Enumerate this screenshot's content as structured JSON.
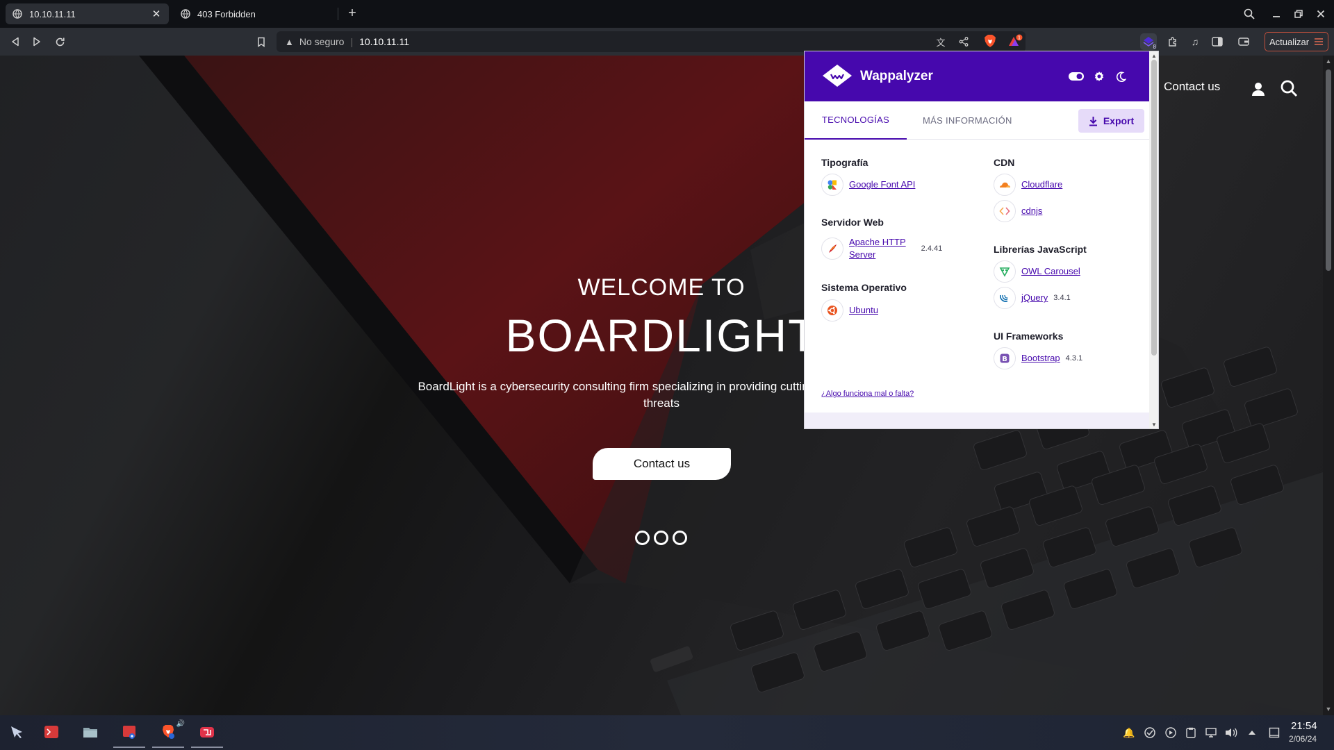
{
  "browser": {
    "tabs": [
      {
        "title": "10.10.11.11",
        "active": true
      },
      {
        "title": "403 Forbidden",
        "active": false
      }
    ],
    "address": {
      "security_label": "No seguro",
      "host": "10.10.11.11"
    },
    "update_label": "Actualizar",
    "extension_badge": "8",
    "rewards_badge": "1"
  },
  "site": {
    "nav_contact": "Contact us",
    "hero": {
      "welcome": "WELCOME TO",
      "title": "BOARDLIGHT",
      "description_line1": "BoardLight is a cybersecurity consulting firm specializing in providing cutting-edge security so",
      "description_line2": "threats",
      "cta": "Contact us"
    }
  },
  "wappalyzer": {
    "name": "Wappalyzer",
    "tabs": {
      "technologies": "TECNOLOGÍAS",
      "more_info": "MÁS INFORMACIÓN"
    },
    "export_label": "Export",
    "categories": {
      "typography": {
        "title": "Tipografía",
        "items": [
          {
            "name": "Google Font API",
            "version": ""
          }
        ]
      },
      "web_server": {
        "title": "Servidor Web",
        "items": [
          {
            "name_line1": "Apache HTTP",
            "name_line2": "Server",
            "version": "2.4.41"
          }
        ]
      },
      "os": {
        "title": "Sistema Operativo",
        "items": [
          {
            "name": "Ubuntu",
            "version": ""
          }
        ]
      },
      "cdn": {
        "title": "CDN",
        "items": [
          {
            "name": "Cloudflare",
            "version": ""
          },
          {
            "name": "cdnjs",
            "version": ""
          }
        ]
      },
      "js_libraries": {
        "title": "Librerías JavaScript",
        "items": [
          {
            "name": "OWL Carousel",
            "version": ""
          },
          {
            "name": "jQuery",
            "version": "3.4.1"
          }
        ]
      },
      "ui_frameworks": {
        "title": "UI Frameworks",
        "items": [
          {
            "name": "Bootstrap",
            "version": "4.3.1"
          }
        ]
      }
    },
    "help_link": "¿Algo funciona mal o falta?"
  },
  "taskbar": {
    "time": "21:54",
    "date": "2/06/24"
  },
  "colors": {
    "wappalyzer_purple": "#4608ad",
    "export_bg": "#e6dbf9",
    "update_border": "#c2503c",
    "brave_orange": "#fb542b"
  },
  "icons": [
    "globe-icon",
    "close-icon",
    "plus-icon",
    "search-icon",
    "minimize-icon",
    "maximize-icon",
    "back-icon",
    "forward-icon",
    "reload-icon",
    "bookmark-icon",
    "warning-icon",
    "translate-icon",
    "share-icon",
    "brave-shields-icon",
    "brave-rewards-icon",
    "wappalyzer-extension-icon",
    "puzzle-icon",
    "music-icon",
    "sidebar-icon",
    "wallet-icon",
    "menu-icon",
    "user-icon",
    "toggle-icon",
    "gear-icon",
    "moon-icon",
    "download-icon"
  ]
}
